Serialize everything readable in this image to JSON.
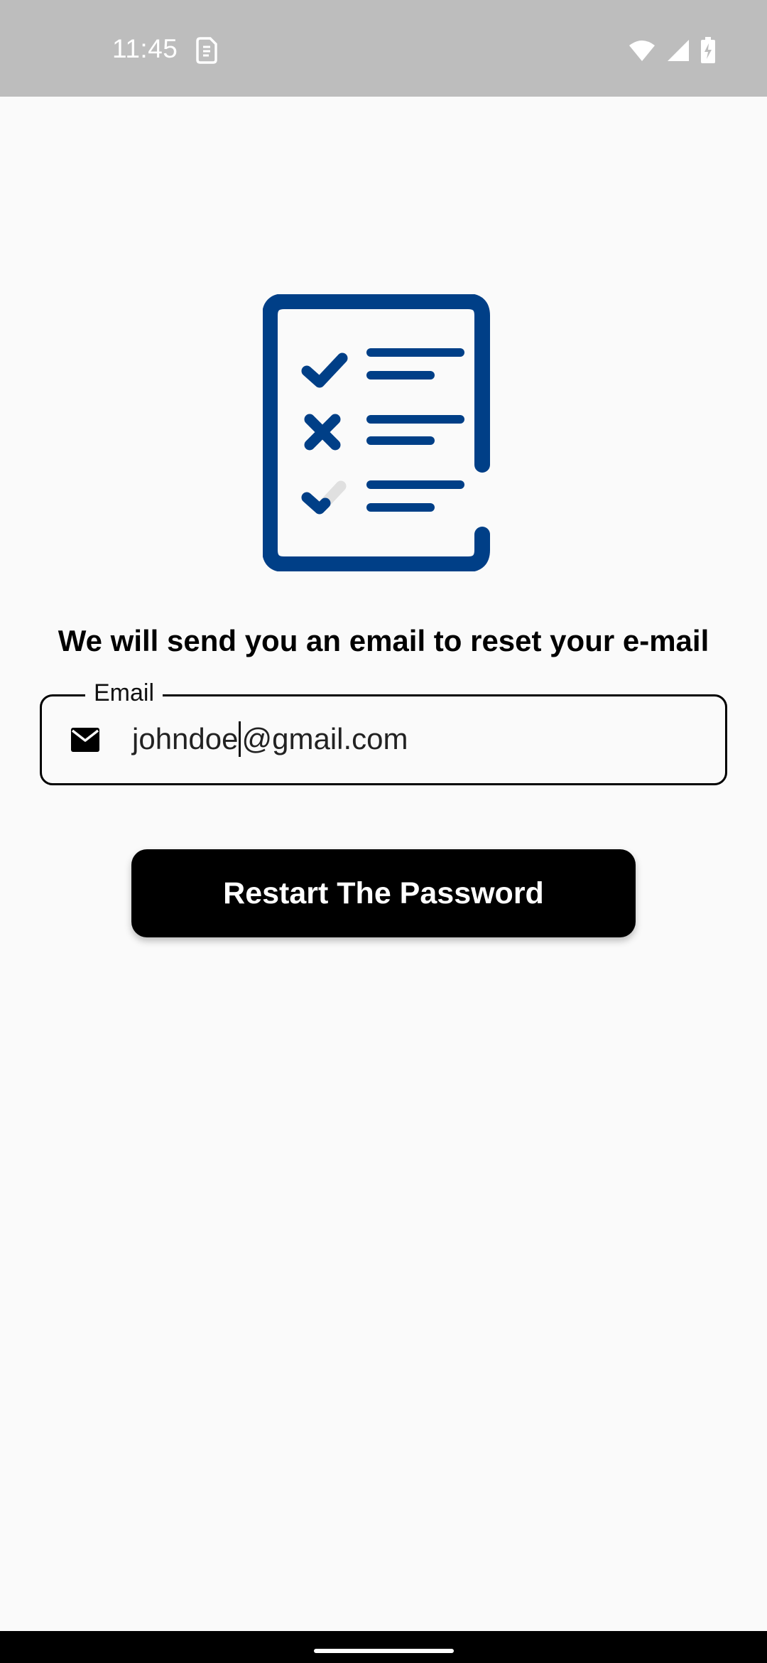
{
  "status_bar": {
    "time": "11:45",
    "icons": [
      "sim-card-icon",
      "wifi-icon",
      "cellular-signal-icon",
      "battery-charging-icon"
    ],
    "text_color": "#ffffff",
    "background": "#bdbdbd"
  },
  "illustration": {
    "icon": "checklist-document-icon",
    "color": "#003f87"
  },
  "headline": "We will send you an email to reset your e-mail",
  "email_field": {
    "label": "Email",
    "icon": "mail-icon",
    "value_before_cursor": "johndoe",
    "value_after_cursor": "@gmail.com"
  },
  "primary_button": {
    "label": "Restart The Password",
    "background": "#000000",
    "text_color": "#ffffff"
  }
}
